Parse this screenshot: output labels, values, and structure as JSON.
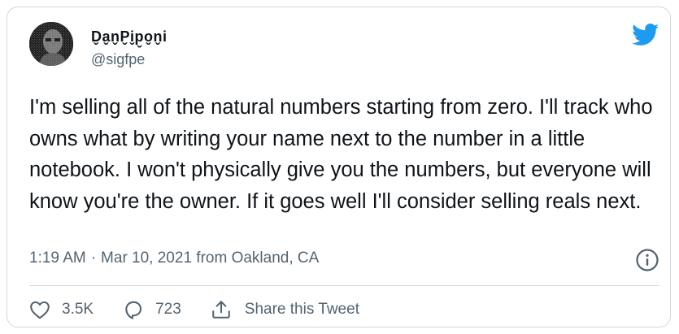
{
  "author": {
    "display_name": "D̬a̬n̬P̬i̬p̬o̬n̬i",
    "handle": "@sigfpe"
  },
  "tweet": {
    "text": "I'm selling all of the natural numbers starting from zero. I'll track who owns what by writing your name next to the number in a little notebook. I won't physically give you the numbers, but everyone will know you're the owner. If it goes well I'll consider selling reals next.",
    "time": "1:19 AM",
    "separator": "·",
    "date": "Mar 10, 2021",
    "location": "from Oakland, CA"
  },
  "actions": {
    "likes": "3.5K",
    "replies": "723",
    "share_label": "Share this Tweet"
  },
  "icons": {
    "brand": "twitter-bird-icon",
    "info": "info-icon",
    "like": "heart-icon",
    "reply": "reply-icon",
    "share": "share-icon"
  },
  "colors": {
    "brand_blue": "#1d9bf0",
    "text_primary": "#0f1419",
    "text_secondary": "#536471",
    "border": "#cfd9de"
  }
}
